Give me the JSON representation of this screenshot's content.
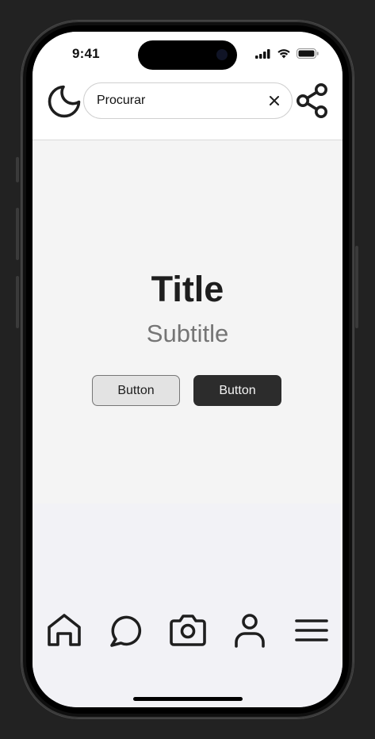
{
  "status_bar": {
    "time": "9:41",
    "icons": [
      "signal-icon",
      "wifi-icon",
      "battery-icon"
    ]
  },
  "header": {
    "theme_toggle_icon": "moon-icon",
    "search": {
      "value": "Procurar",
      "clear_icon": "close-icon"
    },
    "share_icon": "share-icon"
  },
  "main": {
    "title": "Title",
    "subtitle": "Subtitle",
    "secondary_button_label": "Button",
    "primary_button_label": "Button"
  },
  "bottom_nav": {
    "items": [
      {
        "icon": "home-icon"
      },
      {
        "icon": "chat-icon"
      },
      {
        "icon": "camera-icon"
      },
      {
        "icon": "user-icon"
      },
      {
        "icon": "menu-icon"
      }
    ]
  },
  "colors": {
    "device_background": "#222222",
    "header_background": "#ffffff",
    "content_background": "#f4f4f4",
    "nav_background": "#f2f2f6",
    "primary_button": "#2c2c2c",
    "secondary_button": "#e3e3e3",
    "title_text": "#1e1e1e",
    "subtitle_text": "#757575"
  }
}
